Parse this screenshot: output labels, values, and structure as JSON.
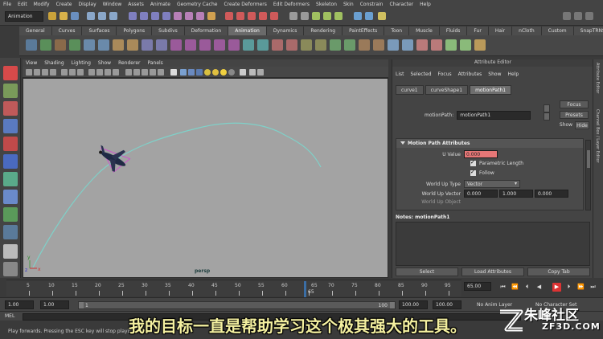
{
  "menubar": {
    "items": [
      "File",
      "Edit",
      "Modify",
      "Create",
      "Display",
      "Window",
      "Assets",
      "Animate",
      "Geometry Cache",
      "Create Deformers",
      "Edit Deformers",
      "Skeleton",
      "Skin",
      "Constrain",
      "Character",
      "Help"
    ]
  },
  "statusline": {
    "mode": "Animation"
  },
  "shelf": {
    "tabs": [
      "General",
      "Curves",
      "Surfaces",
      "Polygons",
      "Subdivs",
      "Deformation",
      "Animation",
      "Dynamics",
      "Rendering",
      "PaintEffects",
      "Toon",
      "Muscle",
      "Fluids",
      "Fur",
      "Hair",
      "nCloth",
      "Custom",
      "SnapTRNS"
    ],
    "active_tab": "Animation"
  },
  "viewport": {
    "menu": [
      "View",
      "Shading",
      "Lighting",
      "Show",
      "Renderer",
      "Panels"
    ],
    "camera": "persp"
  },
  "attribute_editor": {
    "title": "Attribute Editor",
    "menu": [
      "List",
      "Selected",
      "Focus",
      "Attributes",
      "Show",
      "Help"
    ],
    "tabs": [
      "curve1",
      "curveShape1",
      "motionPath1"
    ],
    "active_tab": "motionPath1",
    "node_label": "motionPath:",
    "node_value": "motionPath1",
    "buttons": {
      "focus": "Focus",
      "presets": "Presets",
      "show": "Show",
      "hide": "Hide"
    },
    "section_title": "Motion Path Attributes",
    "u_value_label": "U Value",
    "u_value": "0.000",
    "parametric_length": "Parametric Length",
    "follow": "Follow",
    "world_up_type_label": "World Up Type",
    "world_up_type": "Vector",
    "world_up_vector_label": "World Up Vector",
    "world_up_vector": [
      "0.000",
      "1.000",
      "0.000"
    ],
    "world_up_object_label": "World Up Object",
    "notes_label": "Notes:  motionPath1",
    "bottom_buttons": [
      "Select",
      "Load Attributes",
      "Copy Tab"
    ]
  },
  "sidepanel": {
    "tabs": [
      "Attribute Editor",
      "Channel Box / Layer Editor"
    ]
  },
  "timeslider": {
    "ticks": [
      "5",
      "10",
      "15",
      "20",
      "25",
      "30",
      "35",
      "40",
      "45",
      "50",
      "55",
      "60",
      "65",
      "70",
      "75",
      "80",
      "85",
      "90",
      "95"
    ],
    "current_frame": "65",
    "current_field": "65.00"
  },
  "rangebar": {
    "start": "1.00",
    "range_start": "1.00",
    "range_start_small": "1",
    "range_end": "100",
    "end_a": "100.00",
    "end_b": "100.00",
    "anim_layer": "No Anim Layer",
    "character_set": "No Character Set"
  },
  "cmdline": {
    "label": "MEL",
    "help": "Play forwards. Pressing the ESC key will stop playback."
  },
  "overlay": {
    "subtitle": "我的目标一直是帮助学习这个极其强大的工具。",
    "watermark_text": "朱峰社区",
    "watermark_url": "ZF3D.COM"
  },
  "colors": {
    "viewport_bg": "#a3a3a3",
    "curve": "#7fd1c9",
    "u_value_field": "#e77777",
    "subtitle": "#f4f0a0",
    "timeline_marker": "#3b6ea5"
  }
}
